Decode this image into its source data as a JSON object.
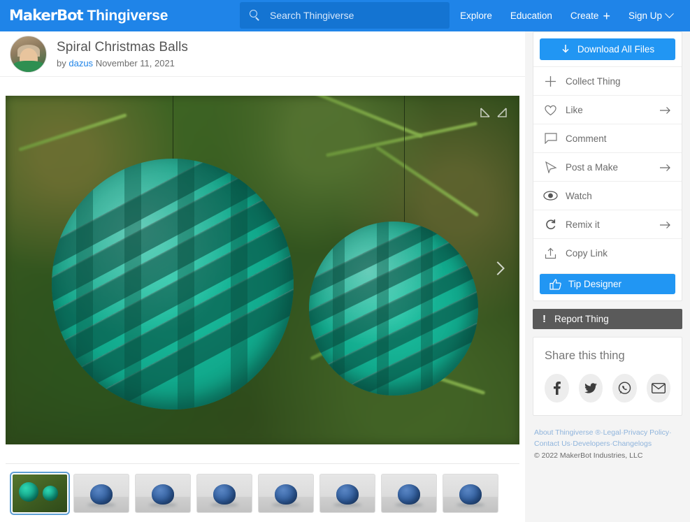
{
  "header": {
    "logo_makerbot": "MakerBot",
    "logo_thingiverse": "Thingiverse",
    "search": {
      "placeholder": "Search Thingiverse",
      "value": "",
      "icon": "search-icon"
    },
    "nav": [
      {
        "label": "Explore",
        "icon": ""
      },
      {
        "label": "Education",
        "icon": ""
      },
      {
        "label": "Create",
        "icon": "plus-icon"
      },
      {
        "label": "Sign Up",
        "icon": "chevron-down-icon"
      }
    ]
  },
  "thing": {
    "title": "Spiral Christmas Balls",
    "by_prefix": "by",
    "author": "dazus",
    "date": "November 11, 2021"
  },
  "viewer": {
    "expand_icon": "expand-icon",
    "next_icon": "chevron-right-icon",
    "thumbnails": [
      {
        "name": "thumb-photo-green-balls",
        "kind": "photo",
        "active": true
      },
      {
        "name": "thumb-render-1",
        "kind": "render",
        "active": false
      },
      {
        "name": "thumb-render-2",
        "kind": "render",
        "active": false
      },
      {
        "name": "thumb-render-3",
        "kind": "render",
        "active": false
      },
      {
        "name": "thumb-render-4",
        "kind": "render",
        "active": false
      },
      {
        "name": "thumb-render-5",
        "kind": "render",
        "active": false
      },
      {
        "name": "thumb-render-6",
        "kind": "render",
        "active": false
      },
      {
        "name": "thumb-render-7",
        "kind": "render",
        "active": false
      }
    ]
  },
  "sidebar": {
    "download_label": "Download All Files",
    "download_icon": "download-arrow-icon",
    "actions": [
      {
        "label": "Collect Thing",
        "icon": "plus-icon",
        "arrow": false
      },
      {
        "label": "Like",
        "icon": "heart-icon",
        "arrow": true
      },
      {
        "label": "Comment",
        "icon": "comment-icon",
        "arrow": false
      },
      {
        "label": "Post a Make",
        "icon": "pencil-icon",
        "arrow": true
      },
      {
        "label": "Watch",
        "icon": "eye-icon",
        "arrow": false
      },
      {
        "label": "Remix it",
        "icon": "remix-icon",
        "arrow": true
      },
      {
        "label": "Copy Link",
        "icon": "share-upload-icon",
        "arrow": false
      }
    ],
    "tip_label": "Tip Designer",
    "tip_icon": "thumbs-up-icon",
    "report_label": "Report Thing",
    "report_icon": "exclamation-icon",
    "share": {
      "title": "Share this thing",
      "icons": [
        {
          "name": "facebook-icon",
          "glyph": "f"
        },
        {
          "name": "twitter-icon",
          "glyph": "t"
        },
        {
          "name": "whatsapp-icon",
          "glyph": "w"
        },
        {
          "name": "email-icon",
          "glyph": "m"
        }
      ]
    },
    "footer": {
      "line1": "About Thingiverse ®·Legal·Privacy Policy·",
      "line2": "Contact Us·Developers·Changelogs",
      "line3": "©  2022 MakerBot Industries, LLC"
    }
  },
  "colors": {
    "brand_blue": "#1f84e8",
    "button_blue": "#2196f3",
    "report_gray": "#5a5a5a",
    "page_bg": "#f4f4f4"
  }
}
